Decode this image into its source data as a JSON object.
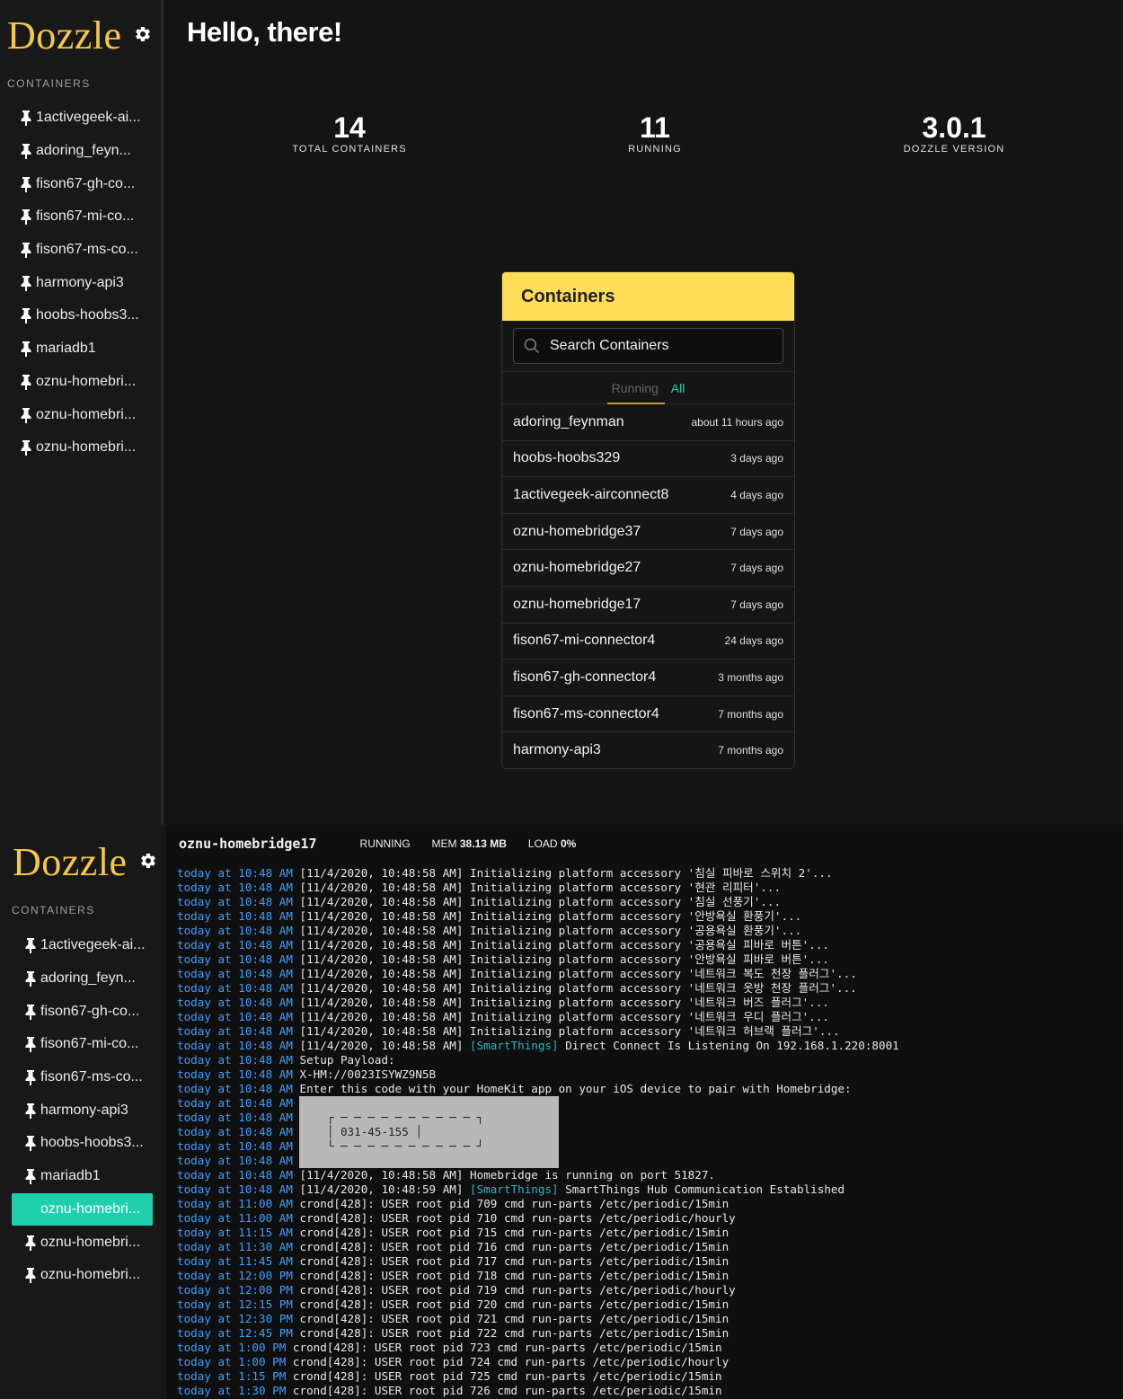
{
  "app": {
    "brand": "Dozzle",
    "section_label": "CONTAINERS",
    "sidebar_items": [
      "1activegeek-ai...",
      "adoring_feyn...",
      "fison67-gh-co...",
      "fison67-mi-co...",
      "fison67-ms-co...",
      "harmony-api3",
      "hoobs-hoobs3...",
      "mariadb1",
      "oznu-homebri...",
      "oznu-homebri...",
      "oznu-homebri..."
    ],
    "bottom_sidebar_items": [
      "1activegeek-ai...",
      "adoring_feyn...",
      "fison67-gh-co...",
      "fison67-mi-co...",
      "fison67-ms-co...",
      "harmony-api3",
      "hoobs-hoobs3...",
      "mariadb1",
      "oznu-homebri...",
      "oznu-homebri...",
      "oznu-homebri..."
    ],
    "active_bottom_index": 8,
    "accent_color": "#1fcfae",
    "brand_color": "#f4c84a"
  },
  "home": {
    "greeting": "Hello, there!",
    "stats": [
      {
        "value": "14",
        "label": "TOTAL CONTAINERS"
      },
      {
        "value": "11",
        "label": "RUNNING"
      },
      {
        "value": "3.0.1",
        "label": "DOZZLE VERSION"
      }
    ],
    "panel": {
      "title": "Containers",
      "search_placeholder": "Search Containers",
      "tabs": {
        "running": "Running",
        "all": "All"
      },
      "containers": [
        {
          "name": "adoring_feynman",
          "age": "about 11 hours ago"
        },
        {
          "name": "hoobs-hoobs329",
          "age": "3 days ago"
        },
        {
          "name": "1activegeek-airconnect8",
          "age": "4 days ago"
        },
        {
          "name": "oznu-homebridge37",
          "age": "7 days ago"
        },
        {
          "name": "oznu-homebridge27",
          "age": "7 days ago"
        },
        {
          "name": "oznu-homebridge17",
          "age": "7 days ago"
        },
        {
          "name": "fison67-mi-connector4",
          "age": "24 days ago"
        },
        {
          "name": "fison67-gh-connector4",
          "age": "3 months ago"
        },
        {
          "name": "fison67-ms-connector4",
          "age": "7 months ago"
        },
        {
          "name": "harmony-api3",
          "age": "7 months ago"
        }
      ]
    }
  },
  "logview": {
    "container_name": "oznu-homebridge17",
    "status": "RUNNING",
    "mem_label": "MEM",
    "mem_value": "38.13 MB",
    "load_label": "LOAD",
    "load_value": "0%",
    "lines": [
      {
        "ts": "today at 10:48 AM",
        "text": "[11/4/2020, 10:48:58 AM] Initializing platform accessory '침실 피바로 스위치 2'..."
      },
      {
        "ts": "today at 10:48 AM",
        "text": "[11/4/2020, 10:48:58 AM] Initializing platform accessory '현관 리피터'..."
      },
      {
        "ts": "today at 10:48 AM",
        "text": "[11/4/2020, 10:48:58 AM] Initializing platform accessory '침실 선풍기'..."
      },
      {
        "ts": "today at 10:48 AM",
        "text": "[11/4/2020, 10:48:58 AM] Initializing platform accessory '안방욕실 환풍기'..."
      },
      {
        "ts": "today at 10:48 AM",
        "text": "[11/4/2020, 10:48:58 AM] Initializing platform accessory '공용욕실 환풍기'..."
      },
      {
        "ts": "today at 10:48 AM",
        "text": "[11/4/2020, 10:48:58 AM] Initializing platform accessory '공용욕실 피바로 버튼'..."
      },
      {
        "ts": "today at 10:48 AM",
        "text": "[11/4/2020, 10:48:58 AM] Initializing platform accessory '안방욕실 피바로 버튼'..."
      },
      {
        "ts": "today at 10:48 AM",
        "text": "[11/4/2020, 10:48:58 AM] Initializing platform accessory '네트워크 복도 천장 플러그'..."
      },
      {
        "ts": "today at 10:48 AM",
        "text": "[11/4/2020, 10:48:58 AM] Initializing platform accessory '네트워크 옷방 천장 플러그'..."
      },
      {
        "ts": "today at 10:48 AM",
        "text": "[11/4/2020, 10:48:58 AM] Initializing platform accessory '네트워크 버즈 플러그'..."
      },
      {
        "ts": "today at 10:48 AM",
        "text": "[11/4/2020, 10:48:58 AM] Initializing platform accessory '네트워크 우디 플러그'..."
      },
      {
        "ts": "today at 10:48 AM",
        "text": "[11/4/2020, 10:48:58 AM] Initializing platform accessory '네트워크 허브랙 플러그'..."
      },
      {
        "ts": "today at 10:48 AM",
        "text": "[11/4/2020, 10:48:58 AM] ",
        "tag": "[SmartThings]",
        "rest": " Direct Connect Is Listening On 192.168.1.220:8001"
      },
      {
        "ts": "today at 10:48 AM",
        "text": "Setup Payload:"
      },
      {
        "ts": "today at 10:48 AM",
        "text": "X-HM://0023ISYWZ9N5B"
      },
      {
        "ts": "today at 10:48 AM",
        "text": "Enter this code with your HomeKit app on your iOS device to pair with Homebridge:"
      },
      {
        "ts": "today at 10:48 AM",
        "qr": "                                      "
      },
      {
        "ts": "today at 10:48 AM",
        "qr": "    ┌ ─ ─ ─ ─ ─ ─ ─ ─ ─ ─ ┐           "
      },
      {
        "ts": "today at 10:48 AM",
        "qr": "    │ 031-45-155 │                    "
      },
      {
        "ts": "today at 10:48 AM",
        "qr": "    └ ─ ─ ─ ─ ─ ─ ─ ─ ─ ─ ┘           "
      },
      {
        "ts": "today at 10:48 AM",
        "qr": "                                      "
      },
      {
        "ts": "today at 10:48 AM",
        "text": "[11/4/2020, 10:48:58 AM] Homebridge is running on port 51827."
      },
      {
        "ts": "today at 10:48 AM",
        "text": "[11/4/2020, 10:48:59 AM] ",
        "tag": "[SmartThings]",
        "rest": " SmartThings Hub Communication Established"
      },
      {
        "ts": "today at 11:00 AM",
        "text": "crond[428]: USER root pid 709 cmd run-parts /etc/periodic/15min"
      },
      {
        "ts": "today at 11:00 AM",
        "text": "crond[428]: USER root pid 710 cmd run-parts /etc/periodic/hourly"
      },
      {
        "ts": "today at 11:15 AM",
        "text": "crond[428]: USER root pid 715 cmd run-parts /etc/periodic/15min"
      },
      {
        "ts": "today at 11:30 AM",
        "text": "crond[428]: USER root pid 716 cmd run-parts /etc/periodic/15min"
      },
      {
        "ts": "today at 11:45 AM",
        "text": "crond[428]: USER root pid 717 cmd run-parts /etc/periodic/15min"
      },
      {
        "ts": "today at 12:00 PM",
        "text": "crond[428]: USER root pid 718 cmd run-parts /etc/periodic/15min"
      },
      {
        "ts": "today at 12:00 PM",
        "text": "crond[428]: USER root pid 719 cmd run-parts /etc/periodic/hourly"
      },
      {
        "ts": "today at 12:15 PM",
        "text": "crond[428]: USER root pid 720 cmd run-parts /etc/periodic/15min"
      },
      {
        "ts": "today at 12:30 PM",
        "text": "crond[428]: USER root pid 721 cmd run-parts /etc/periodic/15min"
      },
      {
        "ts": "today at 12:45 PM",
        "text": "crond[428]: USER root pid 722 cmd run-parts /etc/periodic/15min"
      },
      {
        "ts": "today at 1:00 PM",
        "text": "crond[428]: USER root pid 723 cmd run-parts /etc/periodic/15min"
      },
      {
        "ts": "today at 1:00 PM",
        "text": "crond[428]: USER root pid 724 cmd run-parts /etc/periodic/hourly"
      },
      {
        "ts": "today at 1:15 PM",
        "text": "crond[428]: USER root pid 725 cmd run-parts /etc/periodic/15min"
      },
      {
        "ts": "today at 1:30 PM",
        "text": "crond[428]: USER root pid 726 cmd run-parts /etc/periodic/15min"
      }
    ]
  }
}
